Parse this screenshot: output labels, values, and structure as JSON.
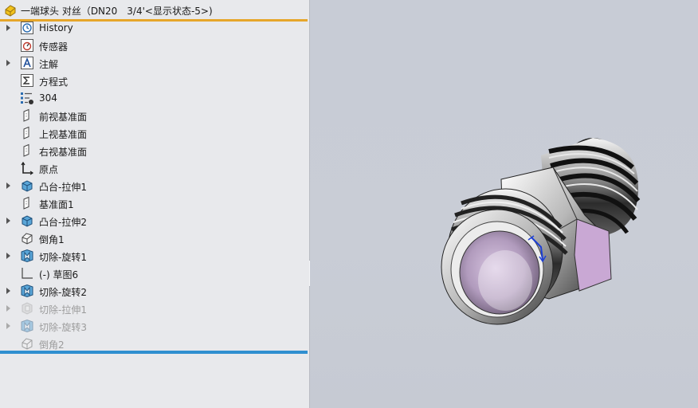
{
  "tree": {
    "title": "一端球头 对丝（DN20　3/4'<显示状态-5>)",
    "items": [
      {
        "label": "History",
        "icon": "history-icon",
        "arrow": true,
        "dim": false
      },
      {
        "label": "传感器",
        "icon": "sensor-icon",
        "arrow": false,
        "dim": false
      },
      {
        "label": "注解",
        "icon": "annotation-icon",
        "arrow": true,
        "dim": false
      },
      {
        "label": "方程式",
        "icon": "equation-icon",
        "arrow": false,
        "dim": false
      },
      {
        "label": "304",
        "icon": "material-icon",
        "arrow": false,
        "dim": false
      },
      {
        "label": "前视基准面",
        "icon": "plane-icon",
        "arrow": false,
        "dim": false
      },
      {
        "label": "上视基准面",
        "icon": "plane-icon",
        "arrow": false,
        "dim": false
      },
      {
        "label": "右视基准面",
        "icon": "plane-icon",
        "arrow": false,
        "dim": false
      },
      {
        "label": "原点",
        "icon": "origin-icon",
        "arrow": false,
        "dim": false
      },
      {
        "label": "凸台-拉伸1",
        "icon": "extrude-icon",
        "arrow": true,
        "dim": false
      },
      {
        "label": "基准面1",
        "icon": "plane-icon",
        "arrow": false,
        "dim": false
      },
      {
        "label": "凸台-拉伸2",
        "icon": "extrude-icon",
        "arrow": true,
        "dim": false
      },
      {
        "label": "倒角1",
        "icon": "chamfer-icon",
        "arrow": false,
        "dim": false
      },
      {
        "label": "切除-旋转1",
        "icon": "revolve-cut-icon",
        "arrow": true,
        "dim": false
      },
      {
        "label": "(-) 草图6",
        "icon": "sketch-icon",
        "arrow": false,
        "dim": false
      },
      {
        "label": "切除-旋转2",
        "icon": "revolve-cut-icon",
        "arrow": true,
        "dim": false
      },
      {
        "label": "切除-拉伸1",
        "icon": "extrude-cut-icon",
        "arrow": true,
        "dim": true
      },
      {
        "label": "切除-旋转3",
        "icon": "revolve-cut-icon",
        "arrow": true,
        "dim": true
      },
      {
        "label": "倒角2",
        "icon": "chamfer-icon",
        "arrow": false,
        "dim": true
      }
    ]
  },
  "colors": {
    "accent_orange": "#e6a62a",
    "rollback_blue": "#2f8fd0",
    "tree_bg": "#e8e9ec",
    "viewport_bg": "#c8ccd6",
    "hex_face": "#c9a8d4"
  },
  "viewport": {
    "model": "pipe-fitting-model"
  }
}
